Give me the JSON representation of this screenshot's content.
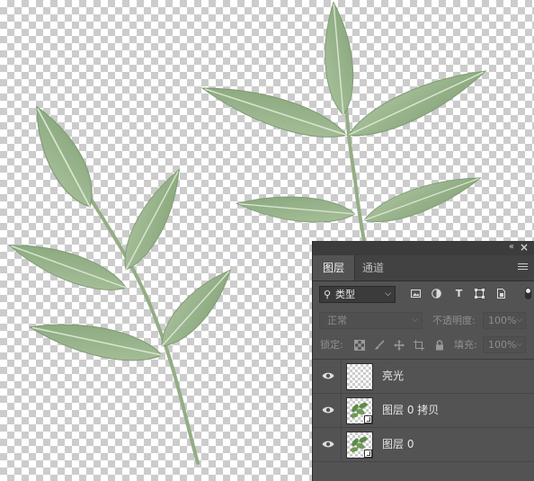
{
  "panel": {
    "tabs": [
      {
        "label": "图层",
        "active": true
      },
      {
        "label": "通道",
        "active": false
      }
    ],
    "filter": {
      "label": "类型",
      "icons": [
        "image-filter-icon",
        "adjustment-filter-icon",
        "type-filter-icon",
        "shape-filter-icon",
        "smart-object-filter-icon"
      ]
    },
    "blend_mode": "正常",
    "opacity_label": "不透明度:",
    "opacity_value": "100%",
    "lock_label": "锁定:",
    "fill_label": "填充:",
    "fill_value": "100%",
    "layers": [
      {
        "name": "亮光",
        "visible": true,
        "thumbnail": "empty",
        "smart_object": false
      },
      {
        "name": "图层 0 拷贝",
        "visible": true,
        "thumbnail": "leaves",
        "smart_object": true
      },
      {
        "name": "图层 0",
        "visible": true,
        "thumbnail": "leaves",
        "smart_object": true
      }
    ]
  },
  "colors": {
    "panel_bg": "#535353",
    "tab_bar_bg": "#424242",
    "leaf_fill": "#9bb58f",
    "leaf_vein": "#d9e6cf",
    "leaf_stem": "#94ad85"
  }
}
